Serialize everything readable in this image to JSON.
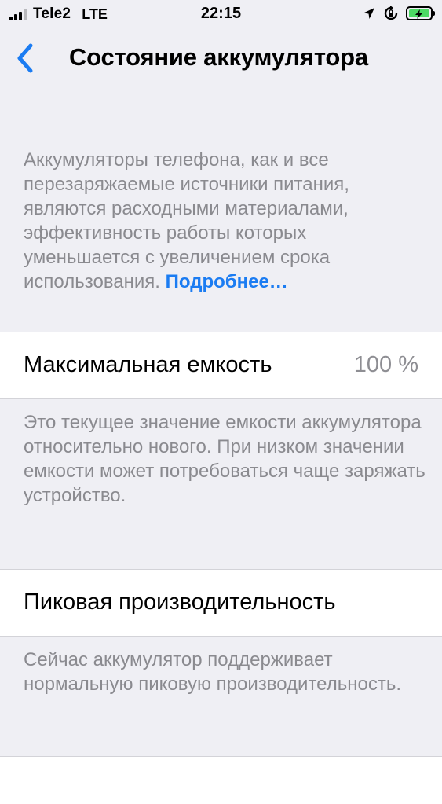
{
  "status_bar": {
    "carrier": "Tele2",
    "network": "LTE",
    "time": "22:15",
    "icons": [
      "signal-icon",
      "location-arrow-icon",
      "rotation-lock-icon",
      "battery-charging-icon"
    ],
    "battery_color": "#4cd964"
  },
  "nav": {
    "back_icon": "chevron-left-icon",
    "title": "Состояние аккумулятора"
  },
  "intro": {
    "text": "Аккумуляторы телефона, как и все перезаряжаемые источники питания, являются расходными материалами, эффективность работы которых уменьшается с увеличением срока использования.",
    "link": "Подробнее…"
  },
  "capacity": {
    "label": "Максимальная емкость",
    "value": "100 %",
    "footer": "Это текущее значение емкости аккумулятора относительно нового. При низком значении емкости может потребоваться чаще заряжать устройство."
  },
  "performance": {
    "label": "Пиковая производительность",
    "footer": "Сейчас аккумулятор поддерживает нормальную пиковую производительность."
  },
  "colors": {
    "background": "#efeff4",
    "accent": "#1b7cf2",
    "secondary_text": "#8a8a8f"
  }
}
